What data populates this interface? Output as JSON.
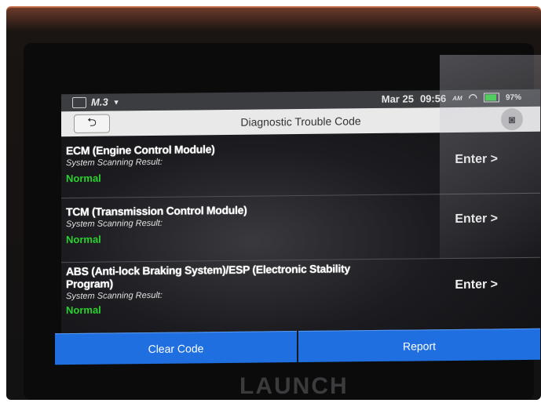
{
  "status_bar": {
    "app_logo": "M.3",
    "date": "Mar 25",
    "time": "09:56",
    "am_pm": "AM",
    "battery": "97%"
  },
  "header": {
    "back_icon": "back-arrow-icon",
    "title": "Diagnostic Trouble Code",
    "camera_icon": "camera-icon"
  },
  "systems": [
    {
      "name": "ECM (Engine Control Module)",
      "result_label": "System Scanning Result:",
      "result": "Normal",
      "action": "Enter >"
    },
    {
      "name": "TCM (Transmission Control Module)",
      "result_label": "System Scanning Result:",
      "result": "Normal",
      "action": "Enter >"
    },
    {
      "name": "ABS (Anti-lock Braking System)/ESP (Electronic Stability Program)",
      "result_label": "System Scanning Result:",
      "result": "Normal",
      "action": "Enter >"
    }
  ],
  "buttons": {
    "clear_code": "Clear Code",
    "report": "Report"
  },
  "device_brand": "LAUNCH",
  "colors": {
    "button_blue": "#1f6fe0",
    "normal_green": "#2bd12f",
    "title_bar": "#e9e9ea"
  }
}
